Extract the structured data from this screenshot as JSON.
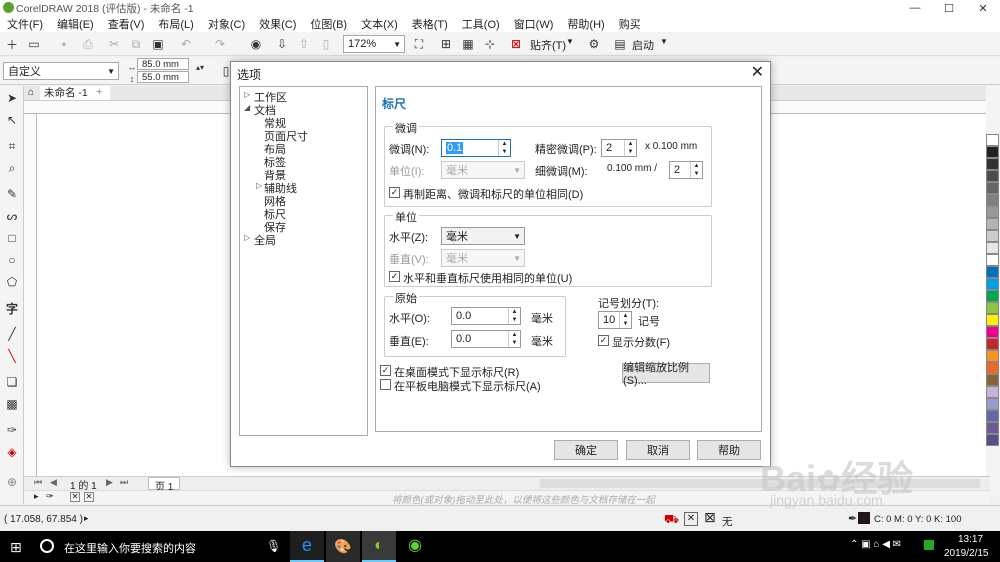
{
  "app": {
    "title": "CorelDRAW 2018 (评估版) - 未命名 -1"
  },
  "menu": [
    "文件(F)",
    "编辑(E)",
    "查看(V)",
    "布局(L)",
    "对象(C)",
    "效果(C)",
    "位图(B)",
    "文本(X)",
    "表格(T)",
    "工具(O)",
    "窗口(W)",
    "帮助(H)",
    "购买"
  ],
  "toolbar": {
    "zoom": "172%",
    "snap": "贴齐(T)",
    "launch": "启动"
  },
  "propbar": {
    "preset": "自定义",
    "width": "85.0 mm",
    "height": "55.0 mm"
  },
  "doc": {
    "tab": "未命名 -1",
    "page_tab": "页 1",
    "page_info": "1 的 1",
    "hint": "将颜色(或对象)拖动至此处，以便将这些颜色与文档存储在一起"
  },
  "status": {
    "coords": "( 17.058, 67.854 )",
    "fill": "无",
    "cmyk": "C: 0 M: 0 Y: 0 K: 100"
  },
  "taskbar": {
    "search": "在这里输入你要搜索的内容",
    "time": "13:17",
    "date": "2019/2/15"
  },
  "watermark": {
    "brand": "Bai",
    "brand2": "经验",
    "url": "jingyan.baidu.com"
  },
  "dialog": {
    "title": "选项",
    "tree": [
      "工作区",
      "文档",
      "常规",
      "页面尺寸",
      "布局",
      "标签",
      "背景",
      "辅助线",
      "网格",
      "标尺",
      "保存",
      "全局"
    ],
    "panel_title": "标尺",
    "nudge": {
      "group": "微调",
      "nudge_label": "微调(N):",
      "nudge_value": "0.1",
      "super_label": "精密微调(P):",
      "super_value": "2",
      "super_unit": "x 0.100 mm",
      "unit_label": "单位(I):",
      "unit_value": "毫米",
      "micro_label": "细微调(M):",
      "micro_text": "0.100 mm /",
      "micro_value": "2",
      "check": "再制距离、微调和标尺的单位相同(D)"
    },
    "units": {
      "group": "单位",
      "h_label": "水平(Z):",
      "h_value": "毫米",
      "v_label": "垂直(V):",
      "v_value": "毫米",
      "check": "水平和垂直标尺使用相同的单位(U)"
    },
    "origin": {
      "group": "原始",
      "h_label": "水平(O):",
      "h_value": "0.0",
      "h_unit": "毫米",
      "v_label": "垂直(E):",
      "v_value": "0.0",
      "v_unit": "毫米"
    },
    "ticks": {
      "label": "记号划分(T):",
      "value": "10",
      "unit": "记号",
      "check": "显示分数(F)"
    },
    "show_desktop": "在桌面模式下显示标尺(R)",
    "show_tablet": "在平板电脑模式下显示标尺(A)",
    "scale_btn": "编辑缩放比例(S)...",
    "ok": "确定",
    "cancel": "取消",
    "help": "帮助"
  },
  "palette": [
    "#ffffff",
    "#222222",
    "#333333",
    "#4d4d4d",
    "#666666",
    "#808080",
    "#999999",
    "#b3b3b3",
    "#cccccc",
    "#e6e6e6",
    "#ffffff",
    "#0072bc",
    "#00a0e9",
    "#00a651",
    "#8dc63f",
    "#fff200",
    "#ec008c",
    "#c1272d",
    "#f7941d",
    "#f26522",
    "#8c6239",
    "#c2b5d6",
    "#9999cc",
    "#6666aa",
    "#6b5b95",
    "#5b4b8a"
  ]
}
